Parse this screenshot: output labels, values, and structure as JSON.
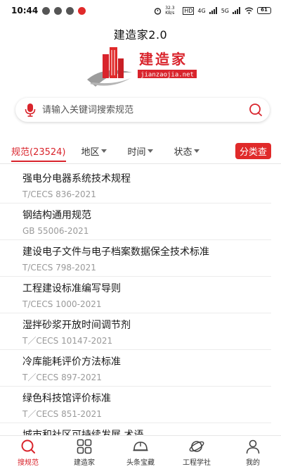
{
  "status_bar": {
    "time": "10:44",
    "network_speed": "32.3 KB/s",
    "cell_label_1": "HD",
    "cell_label_2": "4G",
    "cell_label_3": "5G",
    "battery": "61"
  },
  "app": {
    "title": "建造家2.0"
  },
  "logo": {
    "text_cn": "建造家",
    "text_url": "jianzaojia.net"
  },
  "search": {
    "placeholder": "请输入关键词搜索规范"
  },
  "filters": {
    "tab_standards": "规范(23524)",
    "tab_region": "地区",
    "tab_time": "时间",
    "tab_status": "状态",
    "category_button": "分类查"
  },
  "items": [
    {
      "title": "强电分电器系统技术规程",
      "code": "T/CECS 836-2021"
    },
    {
      "title": "钢结构通用规范",
      "code": "GB 55006-2021"
    },
    {
      "title": "建设电子文件与电子档案数据保全技术标准",
      "code": "T/CECS 798-2021"
    },
    {
      "title": "工程建设标准编写导则",
      "code": "T/CECS 1000-2021"
    },
    {
      "title": "湿拌砂浆开放时间调节剂",
      "code": "T／CECS 10147-2021"
    },
    {
      "title": "冷库能耗评价方法标准",
      "code": "T／CECS 897-2021"
    },
    {
      "title": "绿色科技馆评价标准",
      "code": "T／CECS 851-2021"
    },
    {
      "title": "城市和社区可持续发展 术语",
      "code": ""
    }
  ],
  "nav": {
    "search": "搜规范",
    "builder": "建造家",
    "headlines": "头条宝藏",
    "academy": "工程学社",
    "mine": "我的"
  },
  "colors": {
    "accent": "#d9242c",
    "muted": "#9a9a9a"
  }
}
